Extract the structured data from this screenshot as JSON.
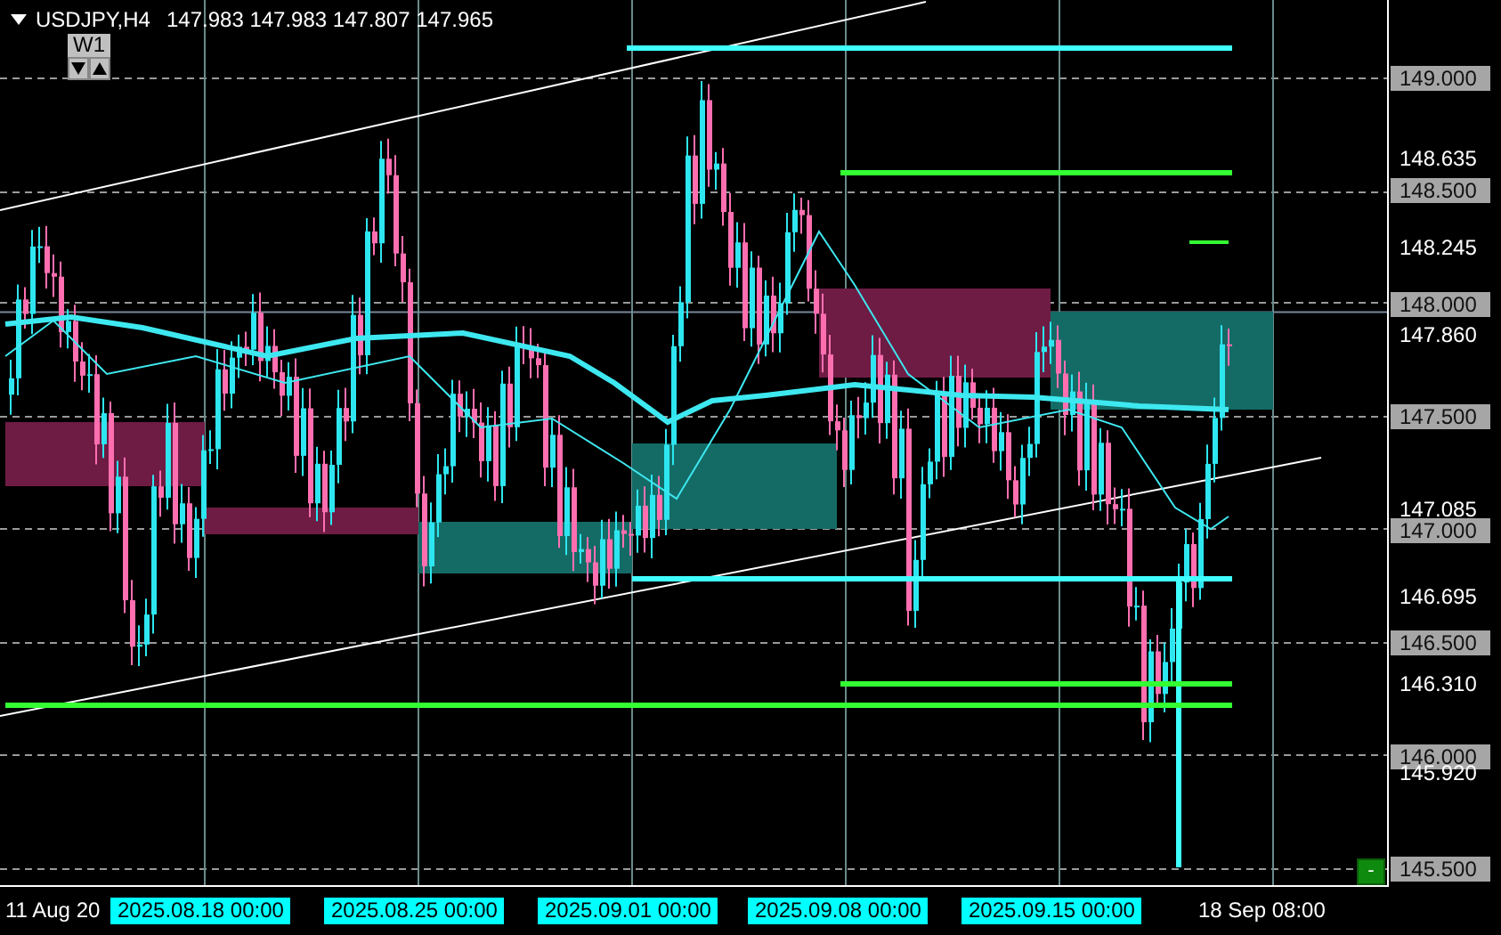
{
  "chart_header": {
    "symbol": "USDJPY,H4",
    "quote": [
      "147.983",
      "147.983",
      "147.807",
      "147.965"
    ]
  },
  "timeframe_panel": {
    "label": "W1"
  },
  "price_axis": [
    {
      "label": "149.000",
      "highlighted": true
    },
    {
      "label": "148.635",
      "highlighted": false
    },
    {
      "label": "148.500",
      "highlighted": true
    },
    {
      "label": "148.245",
      "highlighted": false
    },
    {
      "label": "148.000",
      "highlighted": true
    },
    {
      "label": "147.860",
      "highlighted": false
    },
    {
      "label": "147.500",
      "highlighted": true
    },
    {
      "label": "147.085",
      "highlighted": false
    },
    {
      "label": "147.000",
      "highlighted": true
    },
    {
      "label": "146.695",
      "highlighted": false
    },
    {
      "label": "146.500",
      "highlighted": true
    },
    {
      "label": "146.310",
      "highlighted": false
    },
    {
      "label": "146.000",
      "highlighted": true
    },
    {
      "label": "145.920",
      "highlighted": false
    },
    {
      "label": "145.500",
      "highlighted": true
    }
  ],
  "time_axis": [
    {
      "label": "11 Aug 20",
      "highlighted": false
    },
    {
      "label": "2025.08.18 00:00",
      "highlighted": true
    },
    {
      "label": "2025.08.25 00:00",
      "highlighted": true
    },
    {
      "label": "2025.09.01 00:00",
      "highlighted": true
    },
    {
      "label": "2025.09.08 00:00",
      "highlighted": true
    },
    {
      "label": "2025.09.15 00:00",
      "highlighted": true
    },
    {
      "label": "18 Sep 08:00",
      "highlighted": false
    }
  ],
  "collapse_button": {
    "label": "-"
  }
}
